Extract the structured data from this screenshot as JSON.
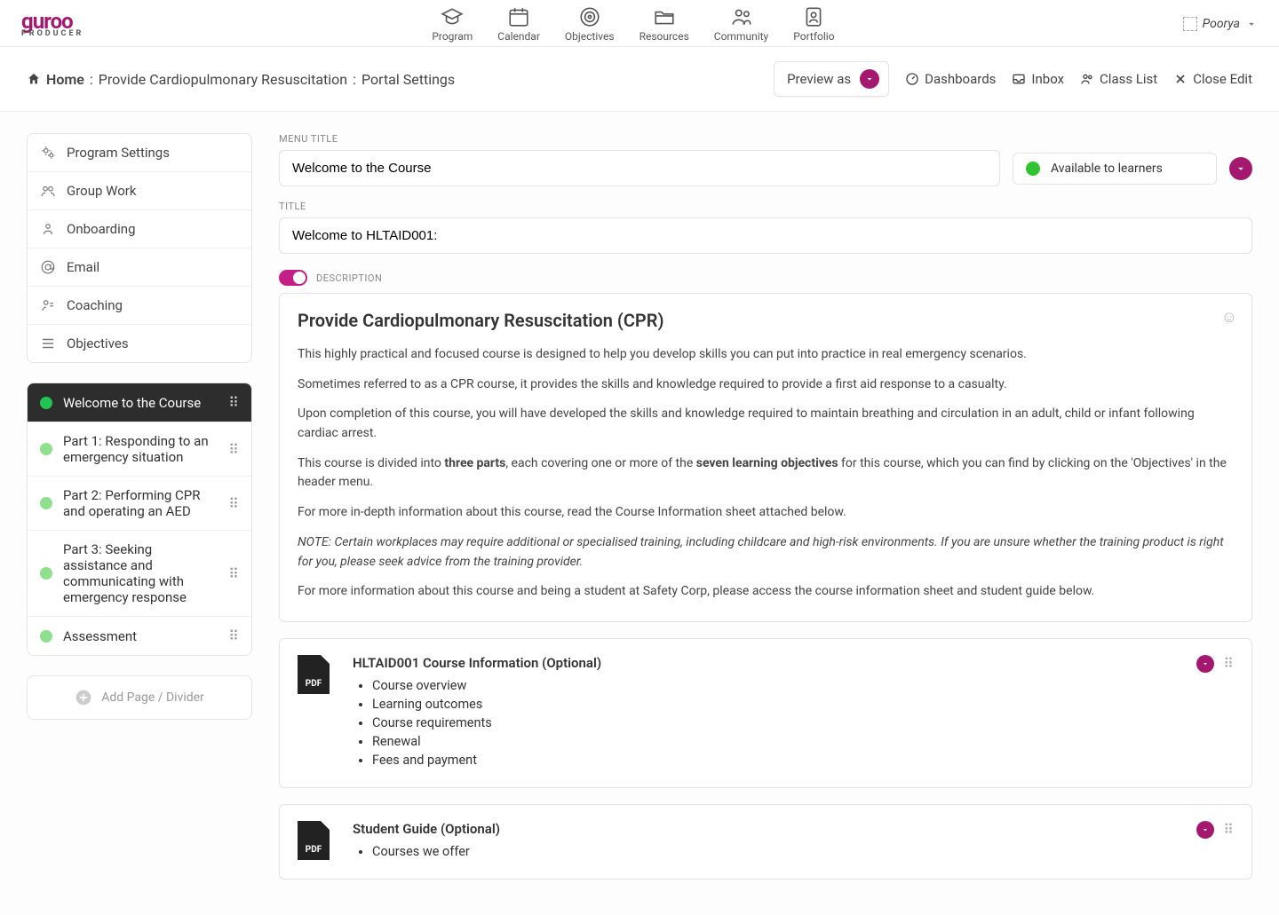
{
  "brand": {
    "name": "guroo",
    "sub": "PRODUCER"
  },
  "nav": [
    {
      "label": "Program"
    },
    {
      "label": "Calendar"
    },
    {
      "label": "Objectives"
    },
    {
      "label": "Resources"
    },
    {
      "label": "Community"
    },
    {
      "label": "Portfolio"
    }
  ],
  "user": {
    "name": "Poorya"
  },
  "breadcrumb": {
    "home": "Home",
    "sep1": ":",
    "course": "Provide Cardiopulmonary Resuscitation",
    "sep2": ":",
    "section": "Portal Settings"
  },
  "toolbar": {
    "preview_as": "Preview as",
    "dashboards": "Dashboards",
    "inbox": "Inbox",
    "class_list": "Class List",
    "close_edit": "Close Edit"
  },
  "sidebar_settings": [
    "Program Settings",
    "Group Work",
    "Onboarding",
    "Email",
    "Coaching",
    "Objectives"
  ],
  "pages": [
    {
      "label": "Welcome to the Course",
      "active": true
    },
    {
      "label": "Part 1: Responding to an emergency situation"
    },
    {
      "label": "Part 2: Performing CPR and operating an AED"
    },
    {
      "label": "Part 3: Seeking assistance and communicating with emergency response"
    },
    {
      "label": "Assessment"
    }
  ],
  "add_page": "Add Page / Divider",
  "fields": {
    "menu_title_label": "MENU TITLE",
    "menu_title_value": "Welcome to the Course",
    "availability": "Available to learners",
    "title_label": "TITLE",
    "title_value": "Welcome to HLTAID001:",
    "description_label": "DESCRIPTION"
  },
  "description": {
    "heading": "Provide Cardiopulmonary Resuscitation (CPR)",
    "p1": "This highly practical and focused course is designed to help you develop skills you can put into practice in real emergency scenarios.",
    "p2": "Sometimes referred to as a CPR course, it provides the skills and knowledge required to provide a first aid response to a casualty.",
    "p3": "Upon completion of this course, you will have developed the skills and knowledge required to maintain breathing and circulation in an adult, child or infant following cardiac arrest.",
    "p4_pre": "This course is divided into ",
    "p4_bold1": "three parts",
    "p4_mid": ", each covering one or more of the ",
    "p4_bold2": "seven learning objectives",
    "p4_post": " for this course, which you can find by clicking on the 'Objectives' in the header menu.",
    "p5": "For more in-depth information about this course, read the Course Information sheet attached below.",
    "p6": "NOTE: Certain workplaces may require additional or specialised training, including childcare and high-risk environments. If you are unsure whether the training product is right for you, please seek advice from the training provider.",
    "p7": "For more information about this course and being a student at Safety Corp, please access the course information sheet and student guide below."
  },
  "attachments": [
    {
      "title": "HLTAID001 Course Information (Optional)",
      "items": [
        "Course overview",
        "Learning outcomes",
        "Course requirements",
        "Renewal",
        "Fees and payment"
      ]
    },
    {
      "title": "Student Guide (Optional)",
      "items": [
        "Courses we offer"
      ]
    }
  ],
  "icons": {
    "pdf": "PDF"
  }
}
